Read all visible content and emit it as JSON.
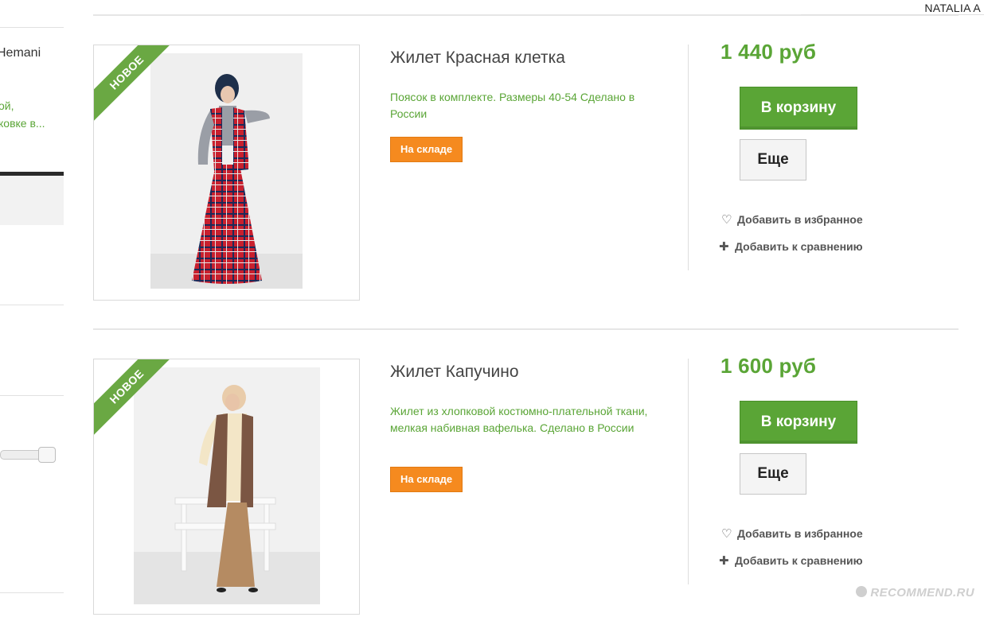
{
  "header": {
    "user_name": "NATALIA A"
  },
  "sidebar": {
    "brand_partial": "Hemani",
    "desc_line1": "ой,",
    "desc_line2": "ковке в..."
  },
  "products": [
    {
      "badge": "НОВОЕ",
      "title": "Жилет Красная клетка",
      "description": "Поясок в комплекте. Размеры 40-54 Сделано в России",
      "stock": "На складе",
      "price": "1 440 руб",
      "cart_label": "В корзину",
      "more_label": "Еще",
      "favorite_label": "Добавить в избранное",
      "compare_label": "Добавить к сравнению"
    },
    {
      "badge": "НОВОЕ",
      "title": "Жилет Капучино",
      "description": "Жилет из хлопковой костюмно-плательной ткани, мелкая набивная вафелька. Сделано в России",
      "stock": "На складе",
      "price": "1 600 руб",
      "cart_label": "В корзину",
      "more_label": "Еще",
      "favorite_label": "Добавить в избранное",
      "compare_label": "Добавить к сравнению"
    }
  ],
  "watermark": "RECOMMEND.RU",
  "colors": {
    "accent_green": "#5aa536",
    "ribbon_green": "#6aa843",
    "stock_orange": "#f58a1f"
  },
  "icons": {
    "favorite": "heart-icon",
    "compare": "plus-icon"
  }
}
